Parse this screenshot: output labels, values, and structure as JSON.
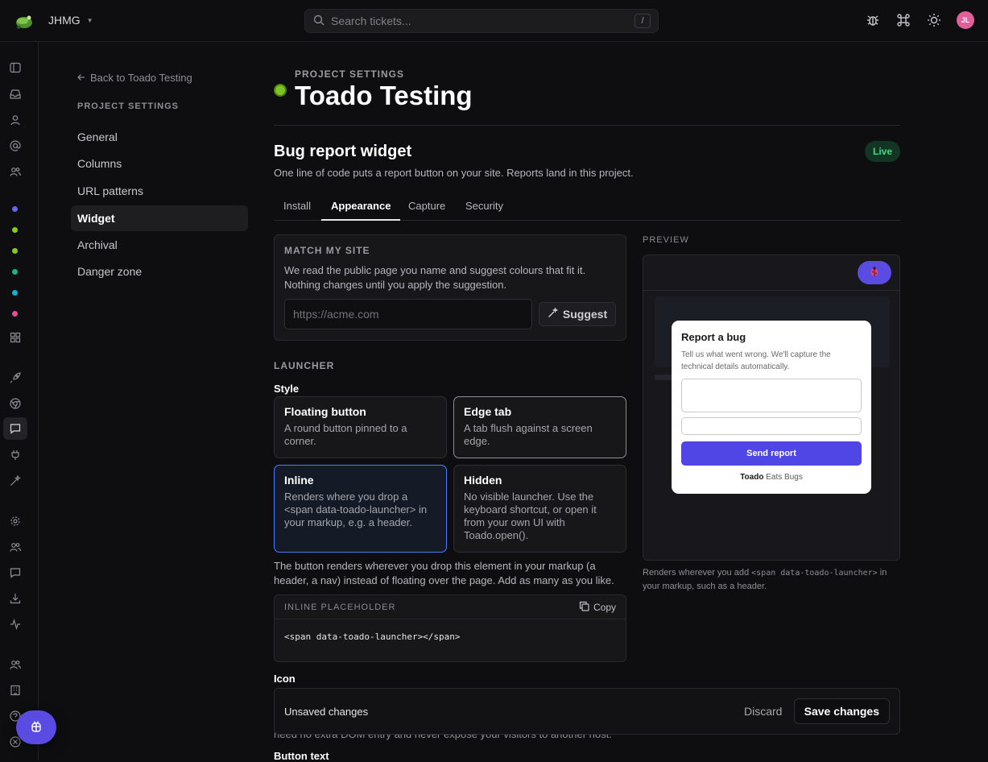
{
  "topbar": {
    "workspace": "JHMG",
    "search_placeholder": "Search tickets...",
    "search_shortcut": "/",
    "avatar_initials": "JL"
  },
  "sidebar": {
    "back_link": "Back to Toado Testing",
    "section": "PROJECT SETTINGS",
    "items": [
      {
        "label": "General"
      },
      {
        "label": "Columns"
      },
      {
        "label": "URL patterns"
      },
      {
        "label": "Widget"
      },
      {
        "label": "Archival"
      },
      {
        "label": "Danger zone"
      }
    ],
    "active_item": "Widget"
  },
  "rail": {
    "project_dot_colors": [
      "#6366f1",
      "#84cc16",
      "#84cc16",
      "#10b981",
      "#06b6d4",
      "#ec4899"
    ]
  },
  "header": {
    "eyebrow": "PROJECT SETTINGS",
    "title": "Toado Testing",
    "status_color": "#7cc422"
  },
  "section": {
    "title": "Bug report widget",
    "badge": "Live",
    "subtitle": "One line of code puts a report button on your site. Reports land in this project."
  },
  "tabs": [
    {
      "label": "Install"
    },
    {
      "label": "Appearance"
    },
    {
      "label": "Capture"
    },
    {
      "label": "Security"
    }
  ],
  "active_tab": "Appearance",
  "match_site": {
    "eyebrow": "MATCH MY SITE",
    "description": "We read the public page you name and suggest colours that fit it. Nothing changes until you apply the suggestion.",
    "url_placeholder": "https://acme.com",
    "suggest_label": "Suggest"
  },
  "launcher": {
    "eyebrow": "LAUNCHER",
    "style_label": "Style",
    "options": [
      {
        "title": "Floating button",
        "desc": "A round button pinned to a corner."
      },
      {
        "title": "Edge tab",
        "desc": "A tab flush against a screen edge."
      },
      {
        "title": "Inline",
        "desc": "Renders where you drop a <span data-toado-launcher> in your markup, e.g. a header."
      },
      {
        "title": "Hidden",
        "desc": "No visible launcher. Use the keyboard shortcut, or open it from your own UI with Toado.open()."
      }
    ],
    "selected": "Inline",
    "inline_note": "The button renders wherever you drop this element in your markup (a header, a nav) instead of floating over the page. Add as many as you like.",
    "code_header": "INLINE PLACEHOLDER",
    "copy_label": "Copy",
    "code": "<span data-toado-launcher></span>"
  },
  "icon_label": "Icon",
  "behind_text": "need no extra DOM entry and never expose your visitors to another host.",
  "button_text_label": "Button text",
  "savebar": {
    "message": "Unsaved changes",
    "discard": "Discard",
    "save": "Save changes"
  },
  "preview": {
    "label": "PREVIEW",
    "popup_title": "Report a bug",
    "popup_desc": "Tell us what went wrong. We'll capture the technical details automatically.",
    "submit": "Send report",
    "brand_strong": "Toado",
    "brand_rest": " Eats Bugs",
    "note_prefix": "Renders wherever you add ",
    "note_code": "<span data-toado-launcher>",
    "note_suffix": " in your markup, such as a header."
  },
  "colors": {
    "accent": "#5a4be2",
    "selected_border": "#4a7cff",
    "live_text": "#3ddc84"
  }
}
